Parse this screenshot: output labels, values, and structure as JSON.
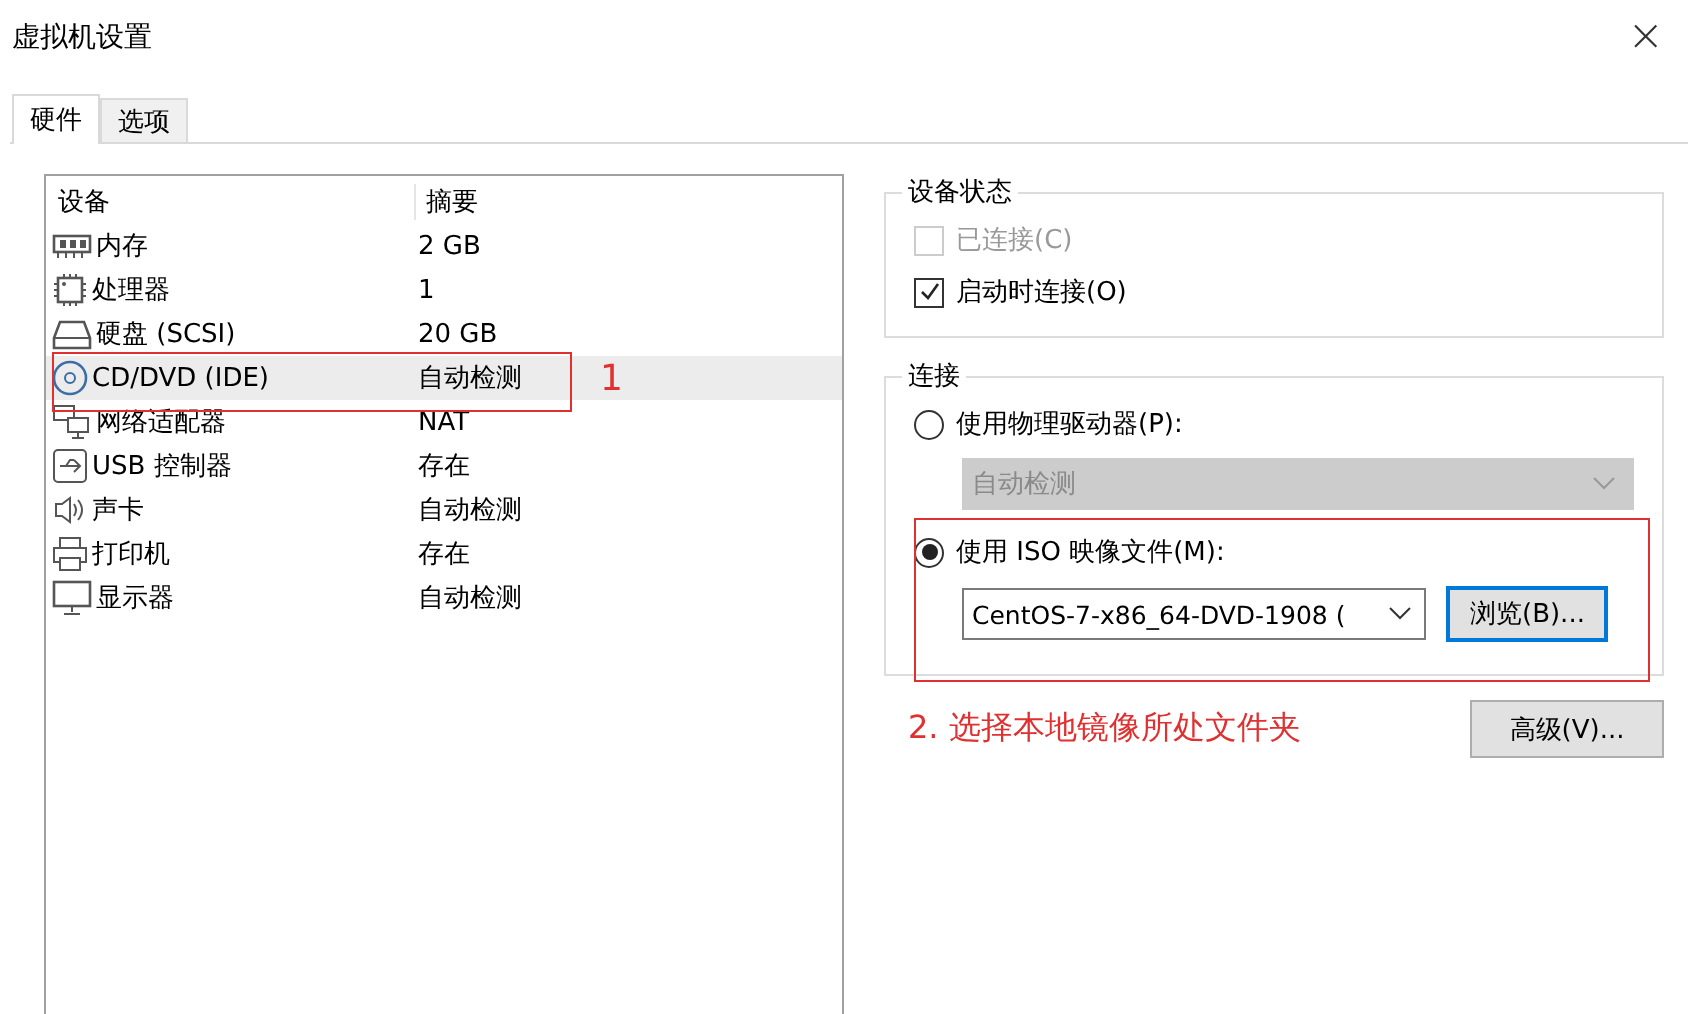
{
  "window": {
    "title": "虚拟机设置",
    "close": "×"
  },
  "tabs": [
    {
      "label": "硬件",
      "selected": true
    },
    {
      "label": "选项",
      "selected": false
    }
  ],
  "devices": {
    "columns": [
      "设备",
      "摘要"
    ],
    "rows": [
      {
        "name": "内存",
        "summary": "2 GB",
        "selected": false
      },
      {
        "name": "处理器",
        "summary": "1",
        "selected": false
      },
      {
        "name": "硬盘 (SCSI)",
        "summary": "20 GB",
        "selected": false
      },
      {
        "name": "CD/DVD (IDE)",
        "summary": "自动检测",
        "selected": true
      },
      {
        "name": "网络适配器",
        "summary": "NAT",
        "selected": false
      },
      {
        "name": "USB 控制器",
        "summary": "存在",
        "selected": false
      },
      {
        "name": "声卡",
        "summary": "自动检测",
        "selected": false
      },
      {
        "name": "打印机",
        "summary": "存在",
        "selected": false
      },
      {
        "name": "显示器",
        "summary": "自动检测",
        "selected": false
      }
    ]
  },
  "device_status": {
    "title": "设备状态",
    "options": [
      {
        "label": "已连接(C)",
        "checked": false,
        "disabled": true
      },
      {
        "label": "启动时连接(O)",
        "checked": true,
        "disabled": false
      }
    ]
  },
  "connection": {
    "title": "连接",
    "physical": {
      "label": "使用物理驱动器(P):",
      "selected": false,
      "dropdown": {
        "value": "自动检测",
        "disabled": true
      }
    },
    "iso": {
      "label": "使用 ISO 映像文件(M):",
      "selected": true,
      "value": "CentOS-7-x86_64-DVD-1908 (",
      "browse": "浏览(B)..."
    }
  },
  "advanced_button": "高级(V)...",
  "annotations": [
    {
      "label": "1"
    },
    {
      "label": "2.  选择本地镜像所处文件夹"
    }
  ]
}
